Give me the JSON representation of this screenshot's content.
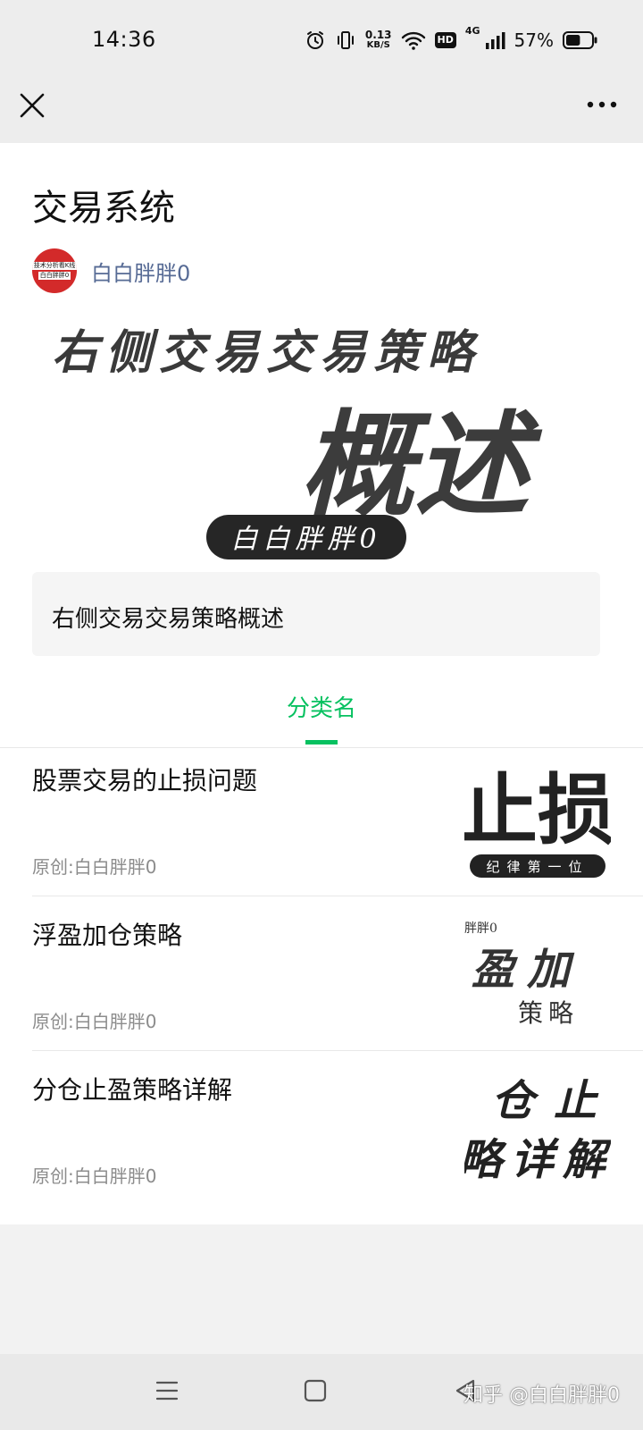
{
  "status_bar": {
    "time": "14:36",
    "net_speed_value": "0.13",
    "net_speed_unit": "KB/S",
    "hd_label": "HD",
    "network_label": "4G",
    "battery_percent": "57%",
    "battery_level": 0.57,
    "icons": [
      "alarm-icon",
      "vibrate-icon",
      "wifi-icon",
      "signal-icon",
      "battery-icon"
    ]
  },
  "nav": {
    "close_icon": "close-icon",
    "more_icon": "more-icon"
  },
  "page": {
    "title": "交易系统",
    "author": "白白胖胖0",
    "avatar_lines": [
      "技术分析看K线",
      "白白胖胖0"
    ],
    "cover": {
      "headline": "右侧交易交易策略",
      "big_text": "概述",
      "author_tag": "白白胖胖0"
    },
    "summary": "右侧交易交易策略概述",
    "category_tab": "分类名"
  },
  "articles": [
    {
      "title": "股票交易的止损问题",
      "meta": "原创:白白胖胖0",
      "thumb_text": "止损",
      "thumb_caption": "纪律第一位"
    },
    {
      "title": "浮盈加仓策略",
      "meta": "原创:白白胖胖0",
      "thumb_small": "胖胖0",
      "thumb_text": "盈加",
      "thumb_caption": "策略"
    },
    {
      "title": "分仓止盈策略详解",
      "meta": "原创:白白胖胖0",
      "thumb_text": "仓止",
      "thumb_caption": "略详解"
    }
  ],
  "bottom_nav": {
    "icons": [
      "menu-icon",
      "home-icon",
      "back-icon"
    ],
    "watermark": "知乎 @白白胖胖0"
  },
  "colors": {
    "accent": "#07c160",
    "author_link": "#576b95",
    "meta_gray": "#8c8c8c"
  }
}
